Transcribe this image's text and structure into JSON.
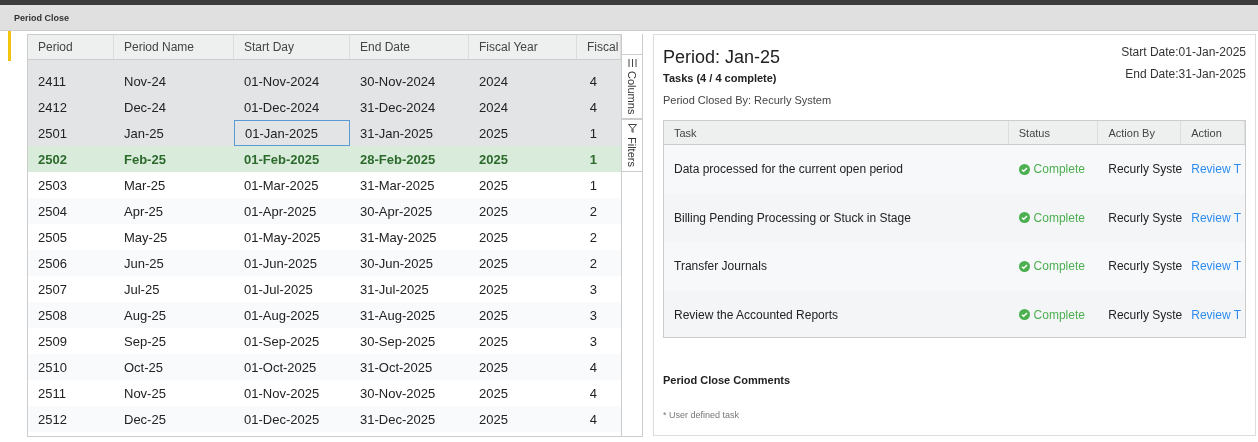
{
  "window": {
    "title": "Period Close"
  },
  "grid": {
    "columns": [
      "Period",
      "Period Name",
      "Start Day",
      "End Date",
      "Fiscal Year",
      "Fiscal"
    ],
    "rows": [
      {
        "cells": [
          "2411",
          "Nov-24",
          "01-Nov-2024",
          "30-Nov-2024",
          "2024",
          "4"
        ],
        "closed": true,
        "current": false,
        "selected": false
      },
      {
        "cells": [
          "2412",
          "Dec-24",
          "01-Dec-2024",
          "31-Dec-2024",
          "2024",
          "4"
        ],
        "closed": true,
        "current": false,
        "selected": false
      },
      {
        "cells": [
          "2501",
          "Jan-25",
          "01-Jan-2025",
          "31-Jan-2025",
          "2025",
          "1"
        ],
        "closed": true,
        "current": false,
        "selected": true
      },
      {
        "cells": [
          "2502",
          "Feb-25",
          "01-Feb-2025",
          "28-Feb-2025",
          "2025",
          "1"
        ],
        "closed": false,
        "current": true,
        "selected": false
      },
      {
        "cells": [
          "2503",
          "Mar-25",
          "01-Mar-2025",
          "31-Mar-2025",
          "2025",
          "1"
        ],
        "closed": false,
        "current": false,
        "selected": false
      },
      {
        "cells": [
          "2504",
          "Apr-25",
          "01-Apr-2025",
          "30-Apr-2025",
          "2025",
          "2"
        ],
        "closed": false,
        "current": false,
        "selected": false
      },
      {
        "cells": [
          "2505",
          "May-25",
          "01-May-2025",
          "31-May-2025",
          "2025",
          "2"
        ],
        "closed": false,
        "current": false,
        "selected": false
      },
      {
        "cells": [
          "2506",
          "Jun-25",
          "01-Jun-2025",
          "30-Jun-2025",
          "2025",
          "2"
        ],
        "closed": false,
        "current": false,
        "selected": false
      },
      {
        "cells": [
          "2507",
          "Jul-25",
          "01-Jul-2025",
          "31-Jul-2025",
          "2025",
          "3"
        ],
        "closed": false,
        "current": false,
        "selected": false
      },
      {
        "cells": [
          "2508",
          "Aug-25",
          "01-Aug-2025",
          "31-Aug-2025",
          "2025",
          "3"
        ],
        "closed": false,
        "current": false,
        "selected": false
      },
      {
        "cells": [
          "2509",
          "Sep-25",
          "01-Sep-2025",
          "30-Sep-2025",
          "2025",
          "3"
        ],
        "closed": false,
        "current": false,
        "selected": false
      },
      {
        "cells": [
          "2510",
          "Oct-25",
          "01-Oct-2025",
          "31-Oct-2025",
          "2025",
          "4"
        ],
        "closed": false,
        "current": false,
        "selected": false
      },
      {
        "cells": [
          "2511",
          "Nov-25",
          "01-Nov-2025",
          "30-Nov-2025",
          "2025",
          "4"
        ],
        "closed": false,
        "current": false,
        "selected": false
      },
      {
        "cells": [
          "2512",
          "Dec-25",
          "01-Dec-2025",
          "31-Dec-2025",
          "2025",
          "4"
        ],
        "closed": false,
        "current": false,
        "selected": false
      }
    ],
    "side_tabs": [
      {
        "label": "Columns",
        "kind": "columns",
        "selected": false
      },
      {
        "label": "Filters",
        "kind": "filters",
        "selected": false
      }
    ]
  },
  "detail": {
    "title": "Period: Jan-25",
    "start_date": "Start Date:01-Jan-2025",
    "end_date": "End Date:31-Jan-2025",
    "tasks_summary": "Tasks (4 / 4 complete)",
    "closed_by": "Period Closed By: Recurly System",
    "task_table": {
      "columns": [
        "Task",
        "Status",
        "Action By",
        "Action"
      ],
      "rows": [
        {
          "task": "Data processed for the current open period",
          "status": "Complete",
          "action_by": "Recurly Syste",
          "action": "Review T"
        },
        {
          "task": "Billing Pending Processing or Stuck in Stage",
          "status": "Complete",
          "action_by": "Recurly Syste",
          "action": "Review T"
        },
        {
          "task": "Transfer Journals",
          "status": "Complete",
          "action_by": "Recurly Syste",
          "action": "Review T"
        },
        {
          "task": "Review the Accounted Reports",
          "status": "Complete",
          "action_by": "Recurly Syste",
          "action": "Review T"
        }
      ]
    },
    "comments_title": "Period Close Comments",
    "footnote": "* User defined task"
  }
}
